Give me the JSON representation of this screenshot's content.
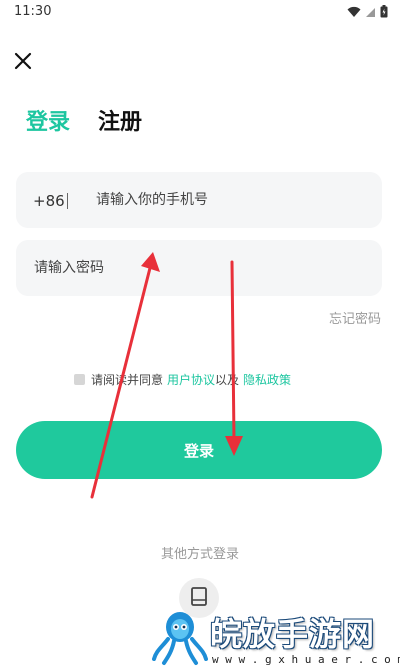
{
  "status_bar": {
    "time": "11:30",
    "icons": [
      "wifi-icon",
      "signal-icon",
      "battery-icon"
    ]
  },
  "close_icon": "close-icon",
  "tabs": [
    {
      "label": "登录",
      "active": true
    },
    {
      "label": "注册",
      "active": false
    }
  ],
  "phone_field": {
    "country_code": "+86",
    "placeholder": "请输入你的手机号"
  },
  "password_field": {
    "placeholder": "请输入密码"
  },
  "forgot_password": "忘记密码",
  "agreement": {
    "prefix": "请阅读并同意",
    "user_agreement": "用户协议",
    "connector": "以及",
    "privacy_policy": "隐私政策",
    "checked": false
  },
  "login_button": "登录",
  "other_login": {
    "title": "其他方式登录",
    "icon": "phone-icon"
  },
  "watermark": {
    "title": "皖放手游网",
    "url": "w w w . g x h u a e r . c o m"
  },
  "colors": {
    "accent": "#1dc6a0",
    "button": "#1fc99d",
    "field_bg": "#f5f6f7",
    "arrow": "#e8303a"
  }
}
